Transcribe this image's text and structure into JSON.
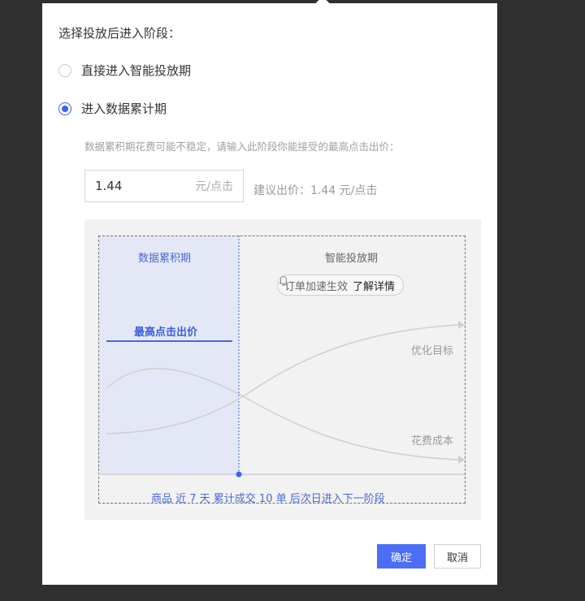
{
  "dialog": {
    "section_title": "选择投放后进入阶段：",
    "options": [
      {
        "label": "直接进入智能投放期",
        "selected": false
      },
      {
        "label": "进入数据累计期",
        "selected": true
      }
    ],
    "description": "数据累积期花费可能不稳定，请输入此阶段你能接受的最高点击出价：",
    "bid_input": {
      "value": "1.44",
      "unit": "元/点击"
    },
    "suggested_bid": "建议出价：1.44 元/点击"
  },
  "diagram": {
    "phase1_label": "数据累积期",
    "phase2_label": "智能投放期",
    "pill_text": "订单加速生效",
    "pill_link": "了解详情",
    "max_bid_label": "最高点击出价",
    "target_label": "优化目标",
    "cost_label": "花费成本",
    "footer_note": "商品 近 7 天 累计成交 10 单 后次日进入下一阶段"
  },
  "buttons": {
    "confirm": "确定",
    "cancel": "取消"
  },
  "colors": {
    "accent": "#4c6ef5",
    "phase1_bg": "#e4e8f6",
    "overlay": "#2f2f2f"
  },
  "icons": {
    "bell": "bell-icon"
  }
}
